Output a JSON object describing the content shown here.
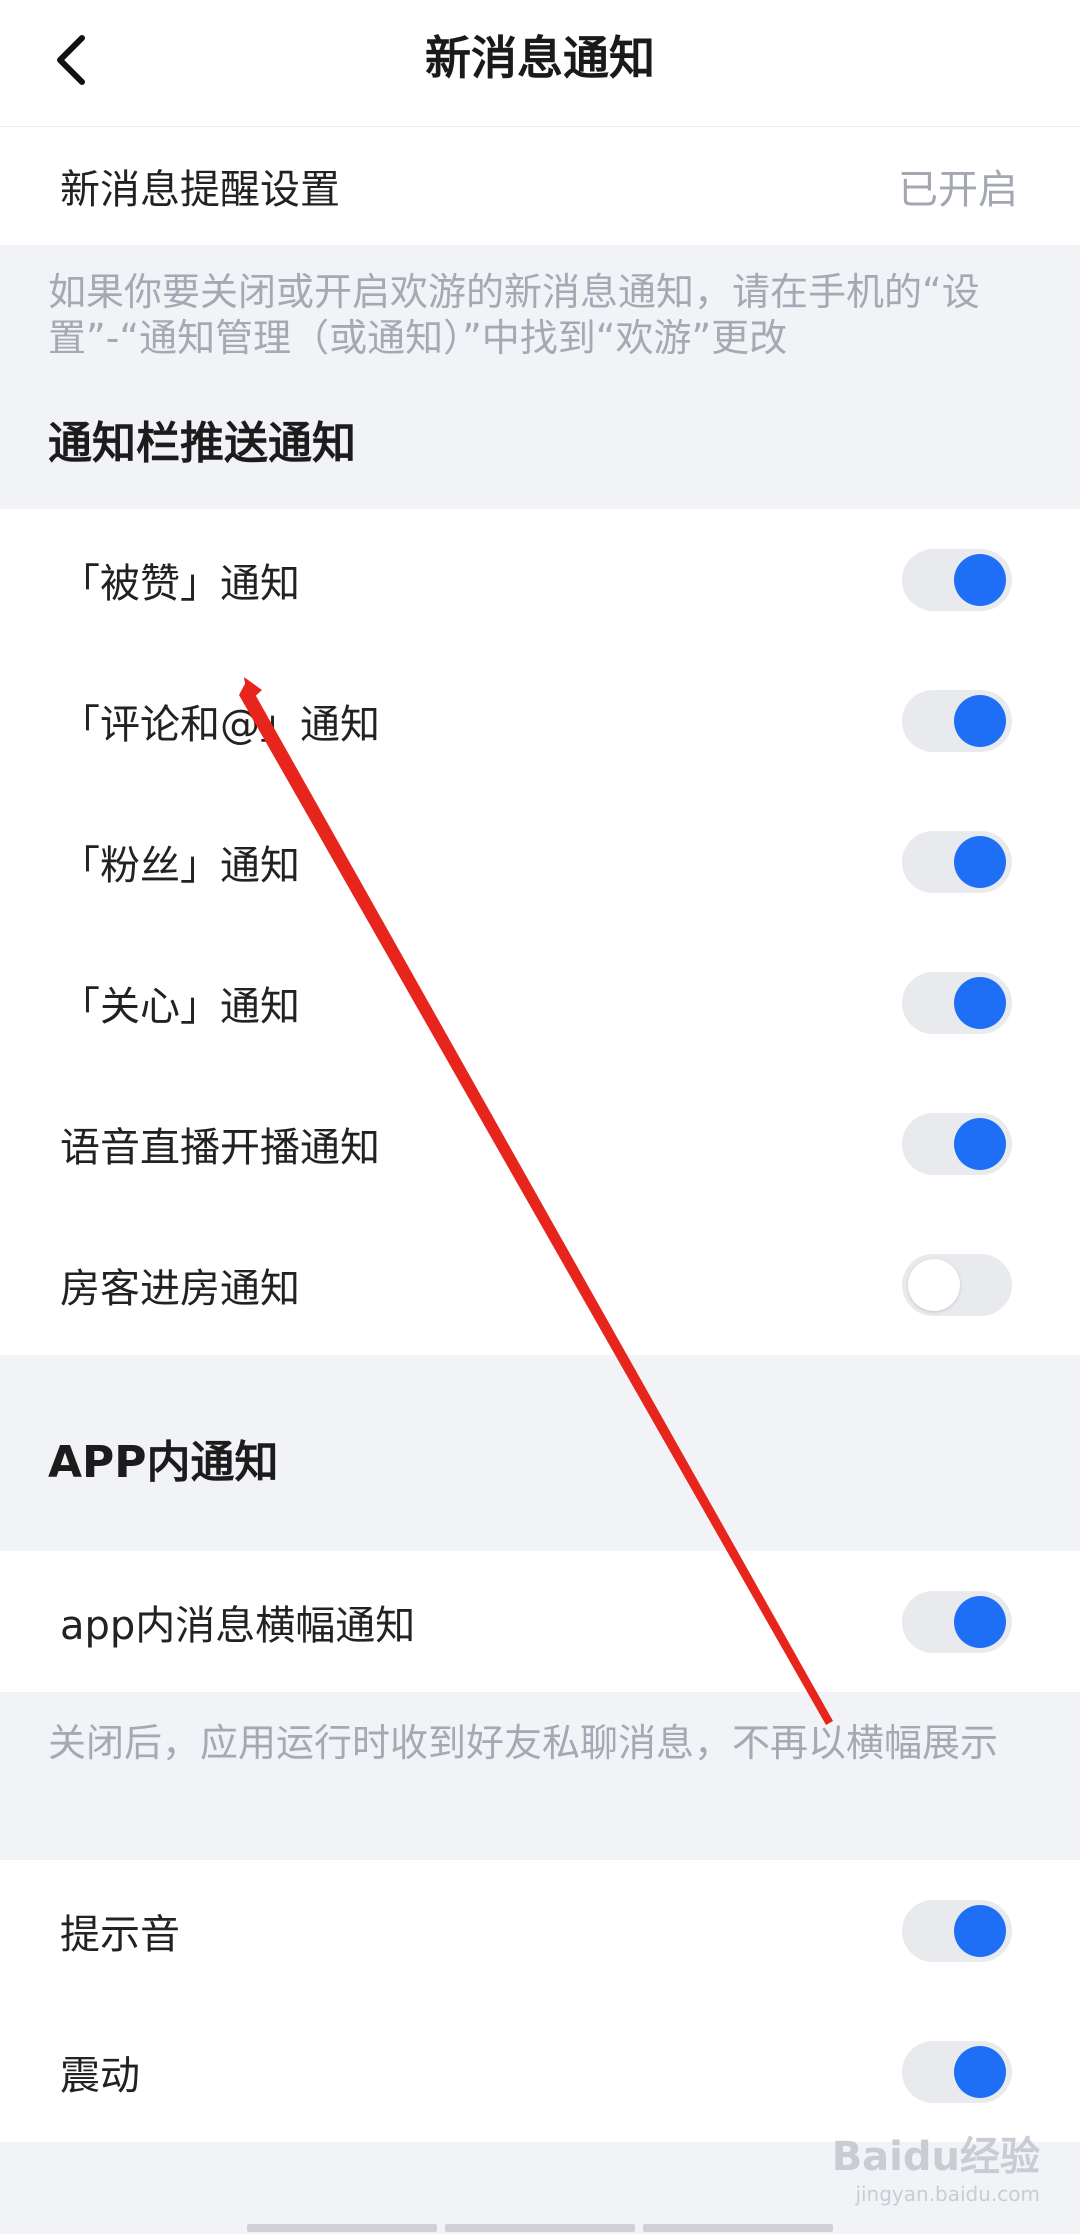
{
  "header": {
    "title": "新消息通知",
    "back_icon": "chevron-left-icon"
  },
  "reminder": {
    "label": "新消息提醒设置",
    "value": "已开启"
  },
  "hint1": "如果你要关闭或开启欢游的新消息通知，请在手机的“设置”-“通知管理（或通知）”中找到“欢游”更改",
  "section1": {
    "title": "通知栏推送通知",
    "items": [
      {
        "label": "「被赞」通知",
        "on": true
      },
      {
        "label": "「评论和@」通知",
        "on": true
      },
      {
        "label": "「粉丝」通知",
        "on": true
      },
      {
        "label": "「关心」通知",
        "on": true
      },
      {
        "label": "语音直播开播通知",
        "on": true
      },
      {
        "label": "房客进房通知",
        "on": false
      }
    ]
  },
  "section2": {
    "title": "APP内通知",
    "banner_label": "app内消息横幅通知",
    "banner_on": true,
    "hint": "关闭后，应用运行时收到好友私聊消息，不再以横幅展示"
  },
  "others": [
    {
      "label": "提示音",
      "on": true
    },
    {
      "label": "震动",
      "on": true
    }
  ],
  "watermark": {
    "main": "Baidu经验",
    "sub": "jingyan.baidu.com"
  },
  "colors": {
    "accent": "#1e6ff5",
    "annotation": "#e8251d",
    "background": "#f2f3f7"
  }
}
